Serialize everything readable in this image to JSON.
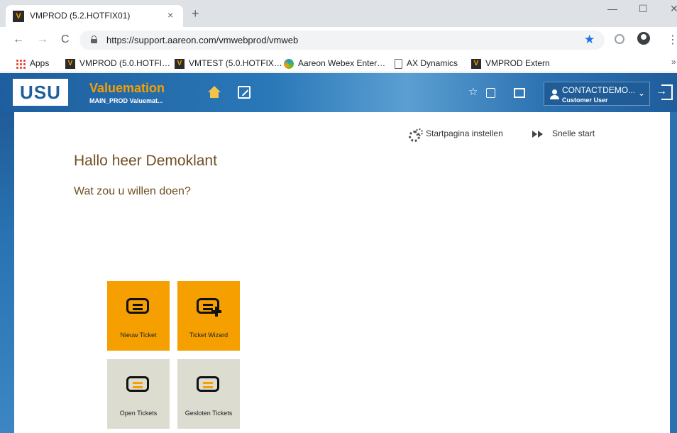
{
  "browser": {
    "tab_title": "VMPROD (5.2.HOTFIX01)",
    "tab_close": "×",
    "new_tab": "+",
    "favicon_letter": "V",
    "window": {
      "minimize": "—",
      "maximize": "☐",
      "close": "✕"
    },
    "nav": {
      "back": "←",
      "forward": "→",
      "reload": "C"
    },
    "url": "https://support.aareon.com/vmwebprod/vmweb",
    "star": "★",
    "menu": "⋮",
    "bookmarks": [
      {
        "label": "Apps",
        "icon": "apps-grid-icon"
      },
      {
        "label": "VMPROD (5.0.HOTFI…",
        "icon": "valuemation-icon"
      },
      {
        "label": "VMTEST (5.0.HOTFIX…",
        "icon": "valuemation-icon"
      },
      {
        "label": "Aareon Webex Enter…",
        "icon": "webex-icon"
      },
      {
        "label": "AX Dynamics",
        "icon": "page-icon"
      },
      {
        "label": "VMPROD Extern",
        "icon": "valuemation-icon"
      }
    ],
    "bookmarks_more": "»"
  },
  "app": {
    "logo": "USU",
    "title": "Valuemation",
    "subtitle": "MAIN_PROD Valuemat...",
    "header_star": "☆",
    "user": {
      "name": "CONTACTDEMO...",
      "role": "Customer User",
      "chevron": "⌄"
    }
  },
  "content": {
    "startpage_link": "Startpagina instellen",
    "quickstart_link": "Snelle start",
    "greeting": "Hallo heer Demoklant",
    "question": "Wat zou u willen doen?",
    "tiles": [
      {
        "label": "Nieuw Ticket",
        "color": "#f5a000"
      },
      {
        "label": "Ticket Wizard",
        "color": "#f5a000"
      },
      {
        "label": "Open Tickets",
        "color": "#dddcd1"
      },
      {
        "label": "Gesloten Tickets",
        "color": "#dddcd1"
      }
    ]
  }
}
